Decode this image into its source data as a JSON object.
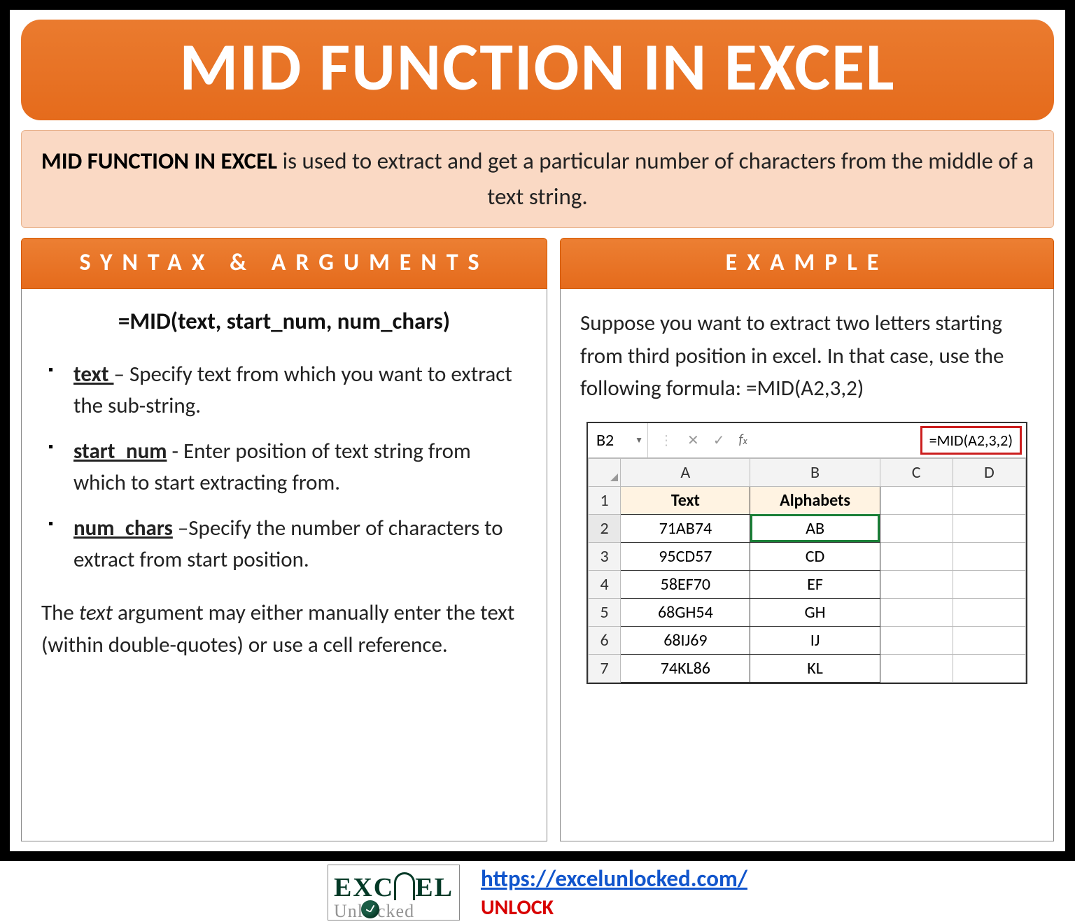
{
  "title": "MID FUNCTION IN EXCEL",
  "intro": {
    "lead": "MID FUNCTION IN EXCEL",
    "rest": " is used to extract and get a particular number of characters from the middle of a text string."
  },
  "headers": {
    "syntax": "SYNTAX & ARGUMENTS",
    "example": "EXAMPLE"
  },
  "syntax": {
    "formula": "=MID(text, start_num, num_chars)",
    "args": [
      {
        "name": "text ",
        "desc": "– Specify text from which you want to extract the sub-string."
      },
      {
        "name": "start_num",
        "desc": " - Enter position of text string from which to start extracting from."
      },
      {
        "name": "num_chars",
        "desc": " –Specify the number of characters to extract from start position."
      }
    ],
    "note_pre": "The ",
    "note_ital": "text",
    "note_post": " argument may either manually enter the text (within double-quotes) or use a cell reference."
  },
  "example": {
    "text": "Suppose you want to extract two letters starting from third position in excel. In that case, use the following formula: =MID(A2,3,2)",
    "namebox": "B2",
    "formula_display": "=MID(A2,3,2)",
    "col_headers": [
      "A",
      "B",
      "C",
      "D"
    ],
    "row_headers": [
      "1",
      "2",
      "3",
      "4",
      "5",
      "6",
      "7"
    ],
    "table_titles": {
      "a": "Text",
      "b": "Alphabets"
    },
    "rows": [
      {
        "a": "71AB74",
        "b": "AB"
      },
      {
        "a": "95CD57",
        "b": "CD"
      },
      {
        "a": "58EF70",
        "b": "EF"
      },
      {
        "a": "68GH54",
        "b": "GH"
      },
      {
        "a": "68IJ69",
        "b": "IJ"
      },
      {
        "a": "74KL86",
        "b": "KL"
      }
    ]
  },
  "footer": {
    "logo_top": "EXC   EL",
    "logo_bottom": "Unl   cked",
    "url": "https://excelunlocked.com/",
    "tag": "UNLOCK"
  }
}
